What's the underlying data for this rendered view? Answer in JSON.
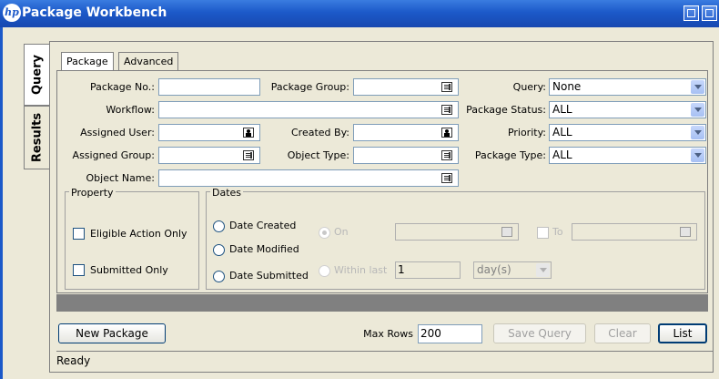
{
  "window": {
    "title": "Package Workbench",
    "logo_text": "hp"
  },
  "side_tabs": {
    "query": "Query",
    "results": "Results"
  },
  "tabs": [
    {
      "label": "Package"
    },
    {
      "label": "Advanced"
    }
  ],
  "form": {
    "package_no": {
      "label": "Package No.:",
      "value": ""
    },
    "package_group": {
      "label": "Package Group:",
      "value": ""
    },
    "query": {
      "label": "Query:",
      "value": "None"
    },
    "workflow": {
      "label": "Workflow:",
      "value": ""
    },
    "package_status": {
      "label": "Package Status:",
      "value": "ALL"
    },
    "assigned_user": {
      "label": "Assigned User:",
      "value": ""
    },
    "created_by": {
      "label": "Created By:",
      "value": ""
    },
    "priority": {
      "label": "Priority:",
      "value": "ALL"
    },
    "assigned_group": {
      "label": "Assigned Group:",
      "value": ""
    },
    "object_type": {
      "label": "Object Type:",
      "value": ""
    },
    "package_type": {
      "label": "Package Type:",
      "value": "ALL"
    },
    "object_name": {
      "label": "Object Name:",
      "value": ""
    }
  },
  "property": {
    "legend": "Property",
    "eligible_action_only": "Eligible Action Only",
    "submitted_only": "Submitted Only"
  },
  "dates": {
    "legend": "Dates",
    "date_created": "Date Created",
    "date_modified": "Date Modified",
    "date_submitted": "Date Submitted",
    "on": "On",
    "to": "To",
    "within_last": "Within last",
    "within_value": "1",
    "unit": "day(s)"
  },
  "bottom": {
    "new_package": "New Package",
    "max_rows_label": "Max Rows",
    "max_rows_value": "200",
    "save_query": "Save Query",
    "clear": "Clear",
    "list": "List"
  },
  "status": "Ready",
  "icons": {
    "list_picker": "list-picker-icon",
    "user_picker": "user-picker-icon",
    "calendar": "calendar-icon",
    "minimize": "minimize-icon",
    "maximize": "maximize-icon"
  },
  "colors": {
    "titlebar": "#1c59c9",
    "background": "#ece9d8"
  }
}
